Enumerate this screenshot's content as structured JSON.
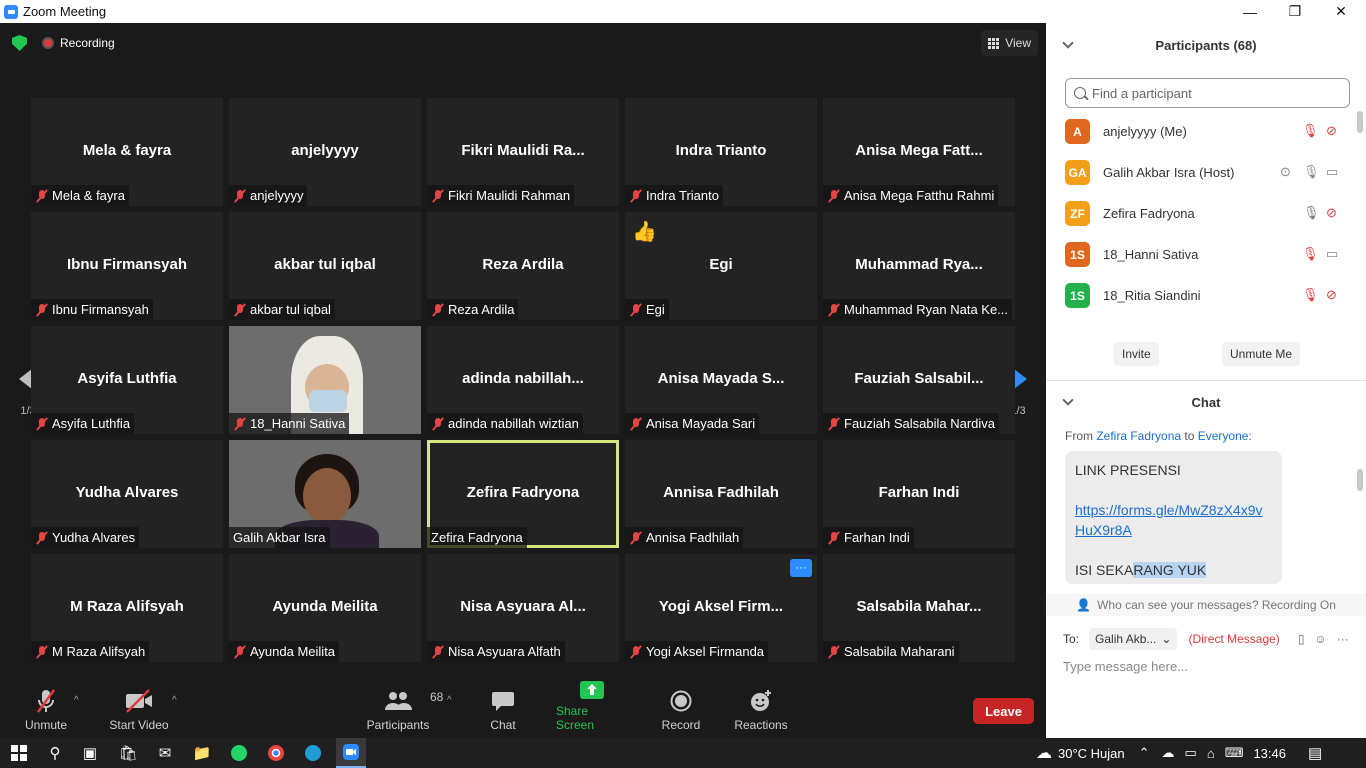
{
  "window": {
    "title": "Zoom Meeting",
    "minimize": "—",
    "restore": "❐",
    "close": "✕"
  },
  "top_bar": {
    "recording_label": "Recording",
    "view_label": "View"
  },
  "pagination": {
    "left": "1/3",
    "right": "1/3"
  },
  "tiles": [
    {
      "big": "Mela & fayra",
      "label": "Mela & fayra"
    },
    {
      "big": "anjelyyyy",
      "label": "anjelyyyy"
    },
    {
      "big": "Fikri  Maulidi  Ra...",
      "label": "Fikri Maulidi Rahman"
    },
    {
      "big": "Indra Trianto",
      "label": "Indra Trianto"
    },
    {
      "big": "Anisa Mega Fatt...",
      "label": "Anisa Mega Fatthu Rahmi"
    },
    {
      "big": "Ibnu Firmansyah",
      "label": "Ibnu Firmansyah"
    },
    {
      "big": "akbar tul iqbal",
      "label": "akbar tul iqbal"
    },
    {
      "big": "Reza Ardila",
      "label": "Reza Ardila"
    },
    {
      "big": "Egi",
      "label": "Egi",
      "reaction": "👍"
    },
    {
      "big": "Muhammad  Rya...",
      "label": "Muhammad Ryan Nata Ke..."
    },
    {
      "big": "Asyifa Luthfia",
      "label": "Asyifa Luthfia"
    },
    {
      "big": "",
      "label": "18_Hanni Sativa"
    },
    {
      "big": "adinda  nabillah...",
      "label": "adinda nabillah wiztian"
    },
    {
      "big": "Anisa  Mayada  S...",
      "label": "Anisa Mayada Sari"
    },
    {
      "big": "Fauziah  Salsabil...",
      "label": "Fauziah Salsabila Nardiva"
    },
    {
      "big": "Yudha Alvares",
      "label": "Yudha Alvares"
    },
    {
      "big": "",
      "label": "Galih Akbar Isra"
    },
    {
      "big": "Zefira Fadryona",
      "label": "Zefira Fadryona"
    },
    {
      "big": "Annisa Fadhilah",
      "label": "Annisa Fadhilah"
    },
    {
      "big": "Farhan Indi",
      "label": "Farhan Indi"
    },
    {
      "big": "M Raza Alifsyah",
      "label": "M Raza Alifsyah"
    },
    {
      "big": "Ayunda Meilita",
      "label": "Ayunda Meilita"
    },
    {
      "big": "Nisa  Asyuara  Al...",
      "label": "Nisa Asyuara Alfath"
    },
    {
      "big": "Yogi  Aksel  Firm...",
      "label": "Yogi Aksel Firmanda",
      "more": "···"
    },
    {
      "big": "Salsabila  Mahar...",
      "label": "Salsabila Maharani"
    }
  ],
  "toolbar": {
    "unmute": "Unmute",
    "start_video": "Start Video",
    "participants": "Participants",
    "participants_count": "68",
    "chat": "Chat",
    "share_screen": "Share Screen",
    "record": "Record",
    "reactions": "Reactions",
    "leave": "Leave",
    "caret": "^"
  },
  "participants_panel": {
    "title": "Participants (68)",
    "search_placeholder": "Find a participant",
    "list": [
      {
        "initials": "A",
        "name": "anjelyyyy (Me)",
        "color": "#e0681e"
      },
      {
        "initials": "GA",
        "name": "Galih Akbar Isra (Host)",
        "color": "#f2a01a"
      },
      {
        "initials": "ZF",
        "name": "Zefira Fadryona",
        "color": "#f2a01a"
      },
      {
        "initials": "1S",
        "name": "18_Hanni Sativa",
        "color": "#e0681e"
      },
      {
        "initials": "1S",
        "name": "18_Ritia Siandini",
        "color": "#23b14d"
      }
    ],
    "invite": "Invite",
    "unmute_me": "Unmute Me"
  },
  "chat_panel": {
    "title": "Chat",
    "from_prefix": "From",
    "from_name": "Zefira Fadryona",
    "to_word": "to",
    "to_name": "Everyone:",
    "msg_line1": "LINK PRESENSI",
    "msg_link": "https://forms.gle/MwZ8zX4x9vHuX9r8A",
    "msg_line3_a": "ISI SEKA",
    "msg_line3_b": "RANG YUK",
    "who_can_see": "Who can see your messages? Recording On",
    "to_label": "To:",
    "to_selected": "Galih Akb...",
    "direct_message": "(Direct Message)",
    "input_placeholder": "Type message here..."
  },
  "taskbar": {
    "weather": "30°C  Hujan",
    "time": "13:46"
  },
  "colors": {
    "meeting_bg": "#1a1a1a",
    "tile_bg": "#232323",
    "active_speaker": "#d6e77a",
    "share_green": "#23c552",
    "leave_red": "#c72525",
    "accent_blue": "#2d8cff"
  }
}
